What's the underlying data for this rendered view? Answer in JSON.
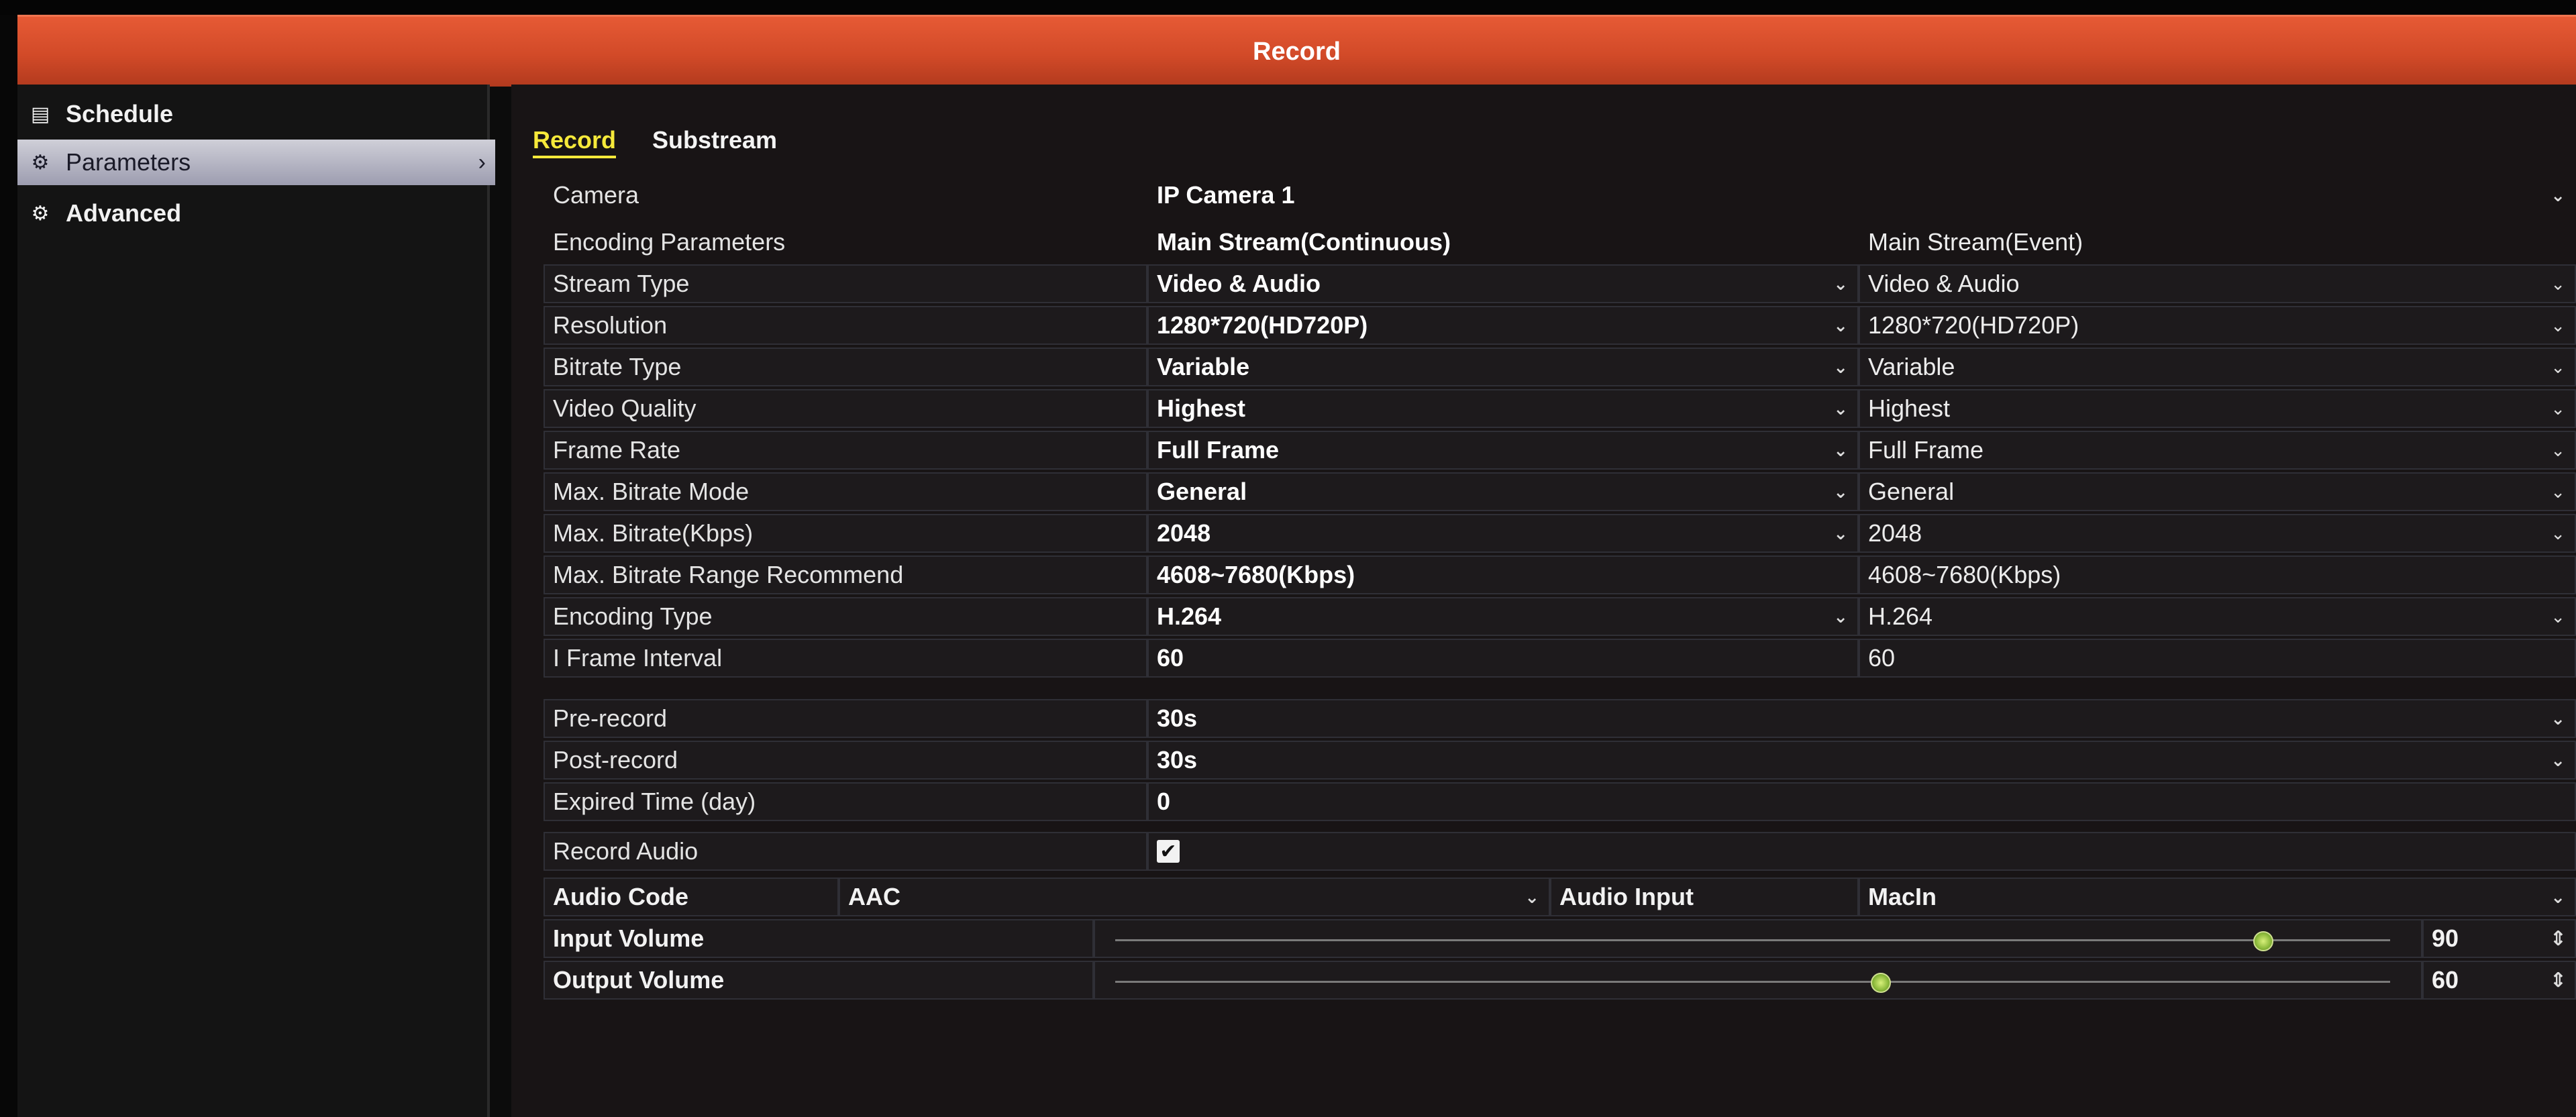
{
  "window": {
    "title": "Record"
  },
  "sidebar": {
    "items": [
      {
        "label": "Schedule",
        "icon": "calendar-icon"
      },
      {
        "label": "Parameters",
        "icon": "gear-icon",
        "selected": true
      },
      {
        "label": "Advanced",
        "icon": "advanced-gear-icon"
      }
    ]
  },
  "tabs": [
    {
      "label": "Record",
      "active": true
    },
    {
      "label": "Substream",
      "active": false
    }
  ],
  "camera": {
    "label": "Camera",
    "value": "IP Camera 1"
  },
  "encoding": {
    "header_label": "Encoding Parameters",
    "col_continuous": "Main Stream(Continuous)",
    "col_event": "Main Stream(Event)",
    "rows": [
      {
        "label": "Stream Type",
        "continuous": "Video & Audio",
        "event": "Video & Audio",
        "dropdown": true
      },
      {
        "label": "Resolution",
        "continuous": "1280*720(HD720P)",
        "event": "1280*720(HD720P)",
        "dropdown": true
      },
      {
        "label": "Bitrate Type",
        "continuous": "Variable",
        "event": "Variable",
        "dropdown": true
      },
      {
        "label": "Video Quality",
        "continuous": "Highest",
        "event": "Highest",
        "dropdown": true
      },
      {
        "label": "Frame Rate",
        "continuous": "Full Frame",
        "event": "Full Frame",
        "dropdown": true
      },
      {
        "label": "Max. Bitrate Mode",
        "continuous": "General",
        "event": "General",
        "dropdown": true
      },
      {
        "label": "Max. Bitrate(Kbps)",
        "continuous": "2048",
        "event": "2048",
        "dropdown": true
      },
      {
        "label": "Max. Bitrate Range Recommend",
        "continuous": "4608~7680(Kbps)",
        "event": "4608~7680(Kbps)",
        "dropdown": false
      },
      {
        "label": "Encoding Type",
        "continuous": "H.264",
        "event": "H.264",
        "dropdown": true
      },
      {
        "label": "I Frame Interval",
        "continuous": "60",
        "event": "60",
        "dropdown": false
      }
    ]
  },
  "record": {
    "pre_record": {
      "label": "Pre-record",
      "value": "30s"
    },
    "post_record": {
      "label": "Post-record",
      "value": "30s"
    },
    "expired_time": {
      "label": "Expired Time (day)",
      "value": "0"
    },
    "record_audio": {
      "label": "Record Audio",
      "checked": true,
      "check_glyph": "✔"
    }
  },
  "audio": {
    "code_label": "Audio Code",
    "code_value": "AAC",
    "input_label": "Audio Input",
    "input_value": "MacIn",
    "input_volume": {
      "label": "Input Volume",
      "value": "90",
      "level": 0.9
    },
    "output_volume": {
      "label": "Output Volume",
      "value": "60",
      "level": 0.6
    }
  },
  "glyphs": {
    "dropdown": "⌄",
    "chevron": "›",
    "spinner": "⇕"
  },
  "colors": {
    "title_bar": "#d24a28",
    "active_tab": "#f6e93a",
    "slider_knob": "#8ab83a"
  }
}
